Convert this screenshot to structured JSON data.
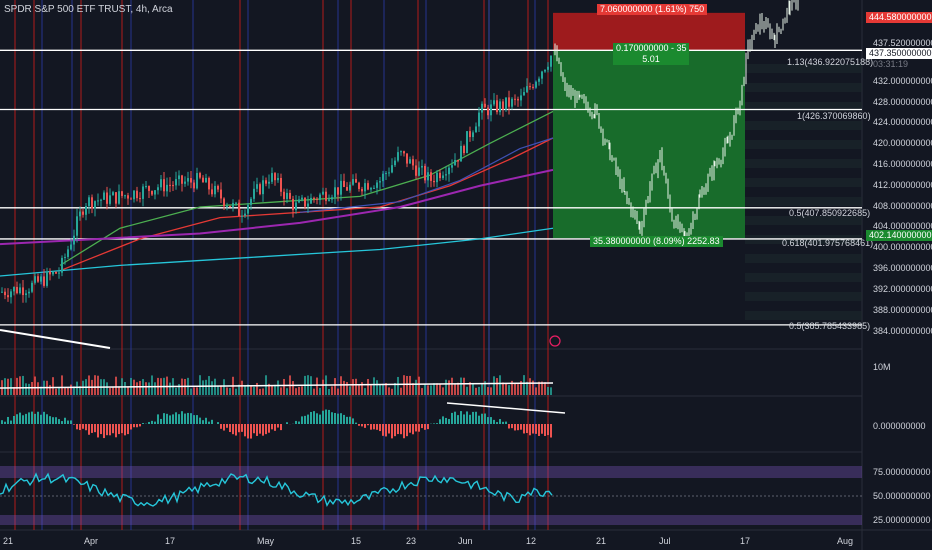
{
  "header": {
    "title": "SPDR S&P 500 ETF TRUST, 4h, Arca"
  },
  "colors": {
    "background": "#131722",
    "up": "#26a69a",
    "down": "#ef5350",
    "white": "#ffffff",
    "profit_zone": "#1b8a2f",
    "loss_zone": "#b71c1c",
    "ma_green": "#4caf50",
    "ma_red": "#e53935",
    "ma_purple": "#9c27b0",
    "ma_teal": "#26c6da",
    "ma_blue": "#3f51b5",
    "rsi_line": "#26c6da",
    "rsi_band": "#7e57c2"
  },
  "price_axis": {
    "labels": [
      "444.580000000",
      "437.520000000",
      "437.350000000",
      "03:31:19",
      "432.000000000",
      "428.000000000",
      "424.000000000",
      "420.000000000",
      "416.000000000",
      "412.000000000",
      "408.000000000",
      "404.000000000",
      "402.140000000",
      "400.000000000",
      "396.000000000",
      "392.000000000",
      "388.000000000",
      "384.000000000"
    ],
    "volume_label": "10M",
    "macd_label": "0.000000000",
    "rsi_labels": [
      "75.000000000",
      "50.000000000",
      "25.000000000"
    ]
  },
  "time_axis": {
    "labels": [
      "21",
      "Apr",
      "17",
      "May",
      "15",
      "23",
      "Jun",
      "12",
      "21",
      "Jul",
      "17",
      "Aug"
    ]
  },
  "fib_levels": [
    {
      "label": "1.13(436.922075188)"
    },
    {
      "label": "1(426.370069860)"
    },
    {
      "label": "0.5(407.850922685)"
    },
    {
      "label": "0.618(401.975768461)"
    },
    {
      "label": "0.5(385.785433985)"
    }
  ],
  "position_tool": {
    "stop_label": "7.060000000 (1.61%) 750",
    "entry_label_1": "0.170000000 - 35",
    "entry_label_2": "5.01",
    "target_label": "35.380000000 (8.09%) 2252.83"
  },
  "chart_data": {
    "type": "candlestick",
    "title": "SPDR S&P 500 ETF TRUST, 4h, Arca",
    "y_range": [
      382,
      447
    ],
    "key_prices": {
      "current": 437.35,
      "stop": 444.58,
      "entry": 437.52,
      "target": 402.14
    },
    "rsi_levels": [
      75,
      50,
      25
    ]
  }
}
